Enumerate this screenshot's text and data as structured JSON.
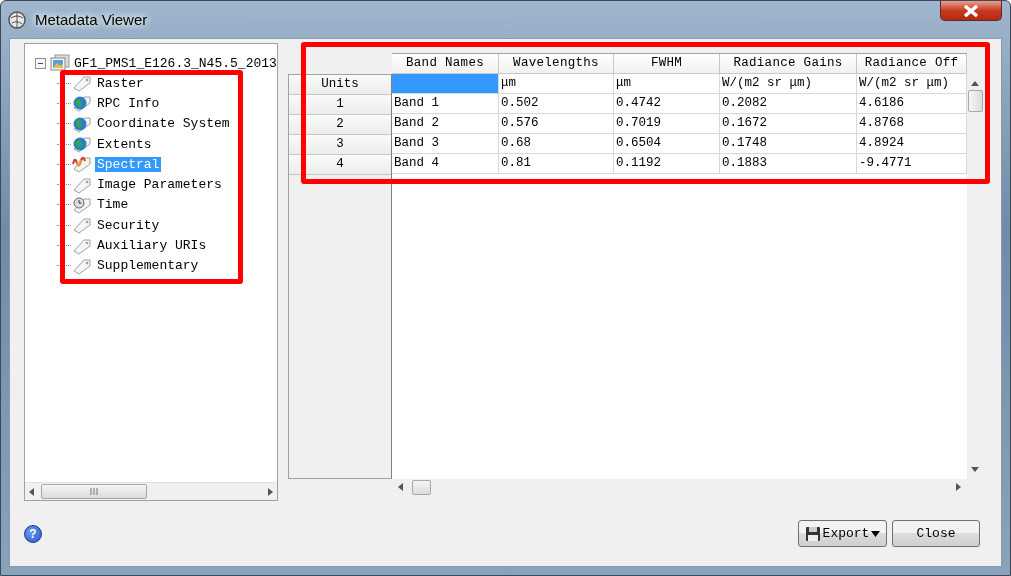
{
  "window": {
    "title": "Metadata Viewer"
  },
  "tree": {
    "root": {
      "label": "GF1_PMS1_E126.3_N45.5_2013",
      "expanded": true,
      "children": [
        {
          "label": "Raster",
          "kind": "tag",
          "selected": false
        },
        {
          "label": "RPC Info",
          "kind": "globe",
          "selected": false
        },
        {
          "label": "Coordinate System",
          "kind": "globe",
          "selected": false
        },
        {
          "label": "Extents",
          "kind": "globe",
          "selected": false
        },
        {
          "label": "Spectral",
          "kind": "wave",
          "selected": true
        },
        {
          "label": "Image Parameters",
          "kind": "tag",
          "selected": false
        },
        {
          "label": "Time",
          "kind": "clock",
          "selected": false
        },
        {
          "label": "Security",
          "kind": "tag",
          "selected": false
        },
        {
          "label": "Auxiliary URIs",
          "kind": "tag",
          "selected": false
        },
        {
          "label": "Supplementary",
          "kind": "tag",
          "selected": false
        }
      ]
    }
  },
  "table": {
    "columns": [
      "Band Names",
      "Wavelengths",
      "FWHM",
      "Radiance Gains",
      "Radiance Off"
    ],
    "units": {
      "header": "Units",
      "cells": [
        {
          "selected": true
        },
        {
          "text": "μm",
          "selected": false
        },
        {
          "text": "μm",
          "selected": false
        },
        {
          "text": "W/(m2 sr μm)",
          "selected": false
        },
        {
          "text": "W/(m2 sr μm)",
          "selected": false
        }
      ]
    },
    "rows": [
      {
        "header": "1",
        "cells": [
          "Band 1",
          "0.502",
          "0.4742",
          "0.2082",
          "4.6186"
        ]
      },
      {
        "header": "2",
        "cells": [
          "Band 2",
          "0.576",
          "0.7019",
          "0.1672",
          "4.8768"
        ]
      },
      {
        "header": "3",
        "cells": [
          "Band 3",
          "0.68",
          "0.6504",
          "0.1748",
          "4.8924"
        ]
      },
      {
        "header": "4",
        "cells": [
          "Band 4",
          "0.81",
          "0.1192",
          "0.1883",
          "-9.4771"
        ]
      }
    ]
  },
  "help": {
    "label": "?"
  },
  "buttons": [
    {
      "label": "Export",
      "kind": "menu"
    },
    {
      "label": "Close",
      "kind": "plain"
    }
  ]
}
